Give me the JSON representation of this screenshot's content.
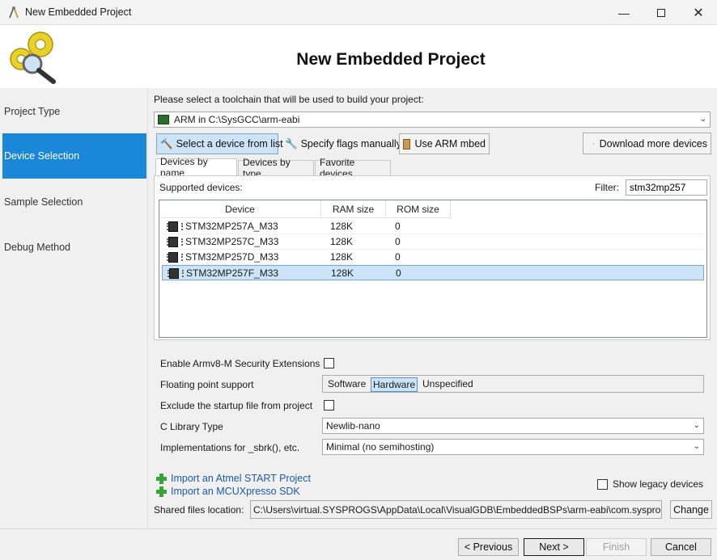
{
  "window": {
    "title": "New Embedded Project",
    "icon": "compass-icon"
  },
  "header": {
    "title": "New Embedded Project",
    "logo": "gears-magnifier-icon"
  },
  "sidebar": {
    "items": [
      {
        "label": "Project Type",
        "active": false
      },
      {
        "label": "Device Selection",
        "active": true
      },
      {
        "label": "Sample Selection",
        "active": false
      },
      {
        "label": "Debug Method",
        "active": false
      }
    ]
  },
  "toolchain": {
    "prompt": "Please select a toolchain that will be used to build your project:",
    "selected": "ARM in C:\\SysGCC\\arm-eabi"
  },
  "mode_buttons": {
    "select_from_list": "Select a device from list",
    "specify_flags": "Specify flags manually",
    "use_mbed": "Use ARM mbed",
    "download_more": "Download more devices"
  },
  "tabs": [
    "Devices by name",
    "Devices by type",
    "Favorite devices"
  ],
  "devices": {
    "supported_label": "Supported devices:",
    "filter_label": "Filter:",
    "filter_value": "stm32mp257",
    "columns": [
      "Device",
      "RAM size",
      "ROM size"
    ],
    "rows": [
      {
        "device": "STM32MP257A_M33",
        "ram": "128K",
        "rom": "0",
        "selected": false
      },
      {
        "device": "STM32MP257C_M33",
        "ram": "128K",
        "rom": "0",
        "selected": false
      },
      {
        "device": "STM32MP257D_M33",
        "ram": "128K",
        "rom": "0",
        "selected": false
      },
      {
        "device": "STM32MP257F_M33",
        "ram": "128K",
        "rom": "0",
        "selected": true
      }
    ]
  },
  "options": {
    "security_ext_label": "Enable Armv8-M Security Extensions",
    "security_ext_checked": false,
    "fp_label": "Floating point support",
    "fp_options": [
      "Software",
      "Hardware",
      "Unspecified"
    ],
    "fp_selected": "Hardware",
    "exclude_startup_label": "Exclude the startup file from project",
    "exclude_startup_checked": false,
    "clib_label": "C Library Type",
    "clib_value": "Newlib-nano",
    "impl_label": "Implementations for _sbrk(), etc.",
    "impl_value": "Minimal (no semihosting)"
  },
  "links": {
    "atmel": "Import an Atmel START Project",
    "mcuxpresso": "Import an MCUXpresso SDK"
  },
  "legacy": {
    "label": "Show legacy devices",
    "checked": false
  },
  "shared": {
    "label": "Shared files location:",
    "path": "C:\\Users\\virtual.SYSPROGS\\AppData\\Local\\VisualGDB\\EmbeddedBSPs\\arm-eabi\\com.sysprogs.a",
    "change": "Change"
  },
  "footer": {
    "previous": "< Previous",
    "next": "Next >",
    "finish": "Finish",
    "cancel": "Cancel"
  }
}
